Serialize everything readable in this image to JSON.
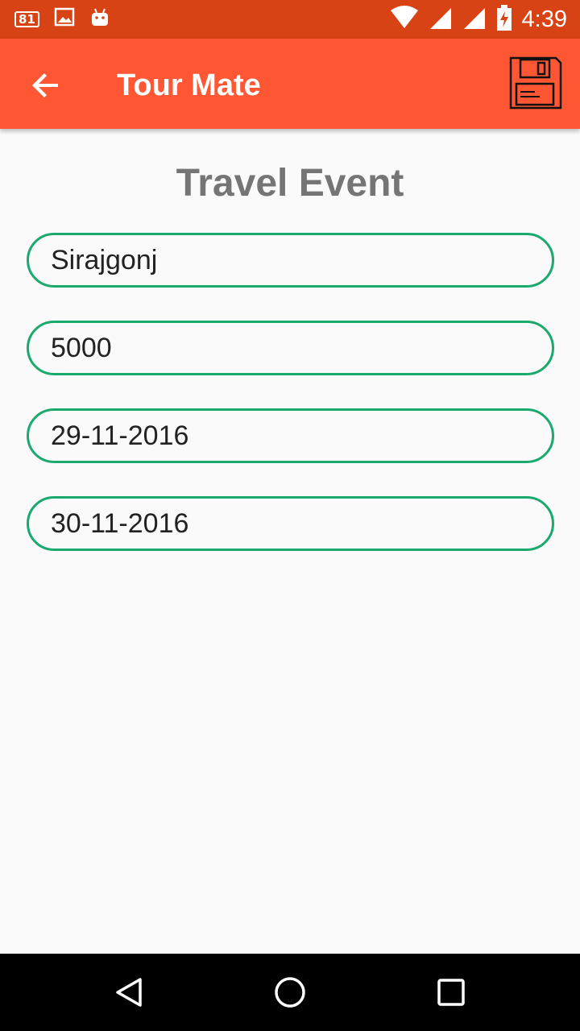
{
  "status_bar": {
    "notification_badge": "81",
    "time": "4:39",
    "icons": [
      "notification-count-icon",
      "image-icon",
      "android-icon",
      "wifi-icon",
      "signal-icon",
      "signal-icon",
      "battery-charging-icon"
    ]
  },
  "app_bar": {
    "title": "Tour Mate",
    "back_icon": "arrow-back-icon",
    "save_icon": "floppy-disk-icon"
  },
  "form": {
    "heading": "Travel Event",
    "fields": [
      {
        "value": "Sirajgonj"
      },
      {
        "value": "5000"
      },
      {
        "value": "29-11-2016"
      },
      {
        "value": "30-11-2016"
      }
    ]
  },
  "nav_bar": {
    "buttons": [
      "back-triangle-icon",
      "home-circle-icon",
      "recents-square-icon"
    ]
  },
  "colors": {
    "status_bar": "#d84315",
    "app_bar": "#ff5733",
    "field_border": "#1aaa6d",
    "heading": "#757575",
    "background": "#fafafa"
  }
}
